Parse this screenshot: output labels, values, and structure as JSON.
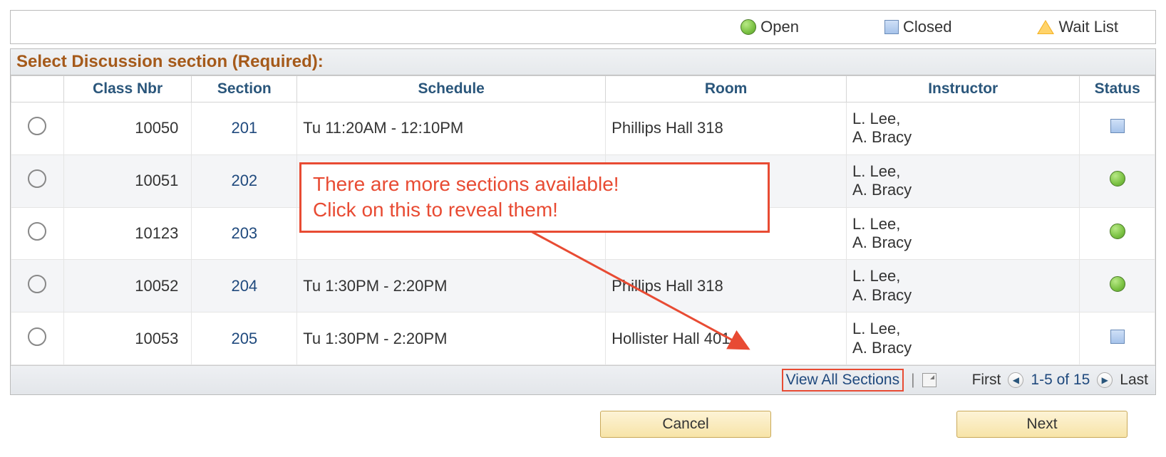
{
  "legend": {
    "open": "Open",
    "closed": "Closed",
    "waitlist": "Wait List"
  },
  "section_title": "Select Discussion section (Required):",
  "columns": {
    "class_nbr": "Class Nbr",
    "section": "Section",
    "schedule": "Schedule",
    "room": "Room",
    "instructor": "Instructor",
    "status": "Status"
  },
  "rows": [
    {
      "nbr": "10050",
      "section": "201",
      "schedule": "Tu 11:20AM - 12:10PM",
      "room": "Phillips Hall 318",
      "instructor": "L. Lee,\nA. Bracy",
      "status": "closed"
    },
    {
      "nbr": "10051",
      "section": "202",
      "schedule": "",
      "room": "",
      "instructor": "L. Lee,\nA. Bracy",
      "status": "open"
    },
    {
      "nbr": "10123",
      "section": "203",
      "schedule": "",
      "room": "",
      "instructor": "L. Lee,\nA. Bracy",
      "status": "open"
    },
    {
      "nbr": "10052",
      "section": "204",
      "schedule": "Tu 1:30PM - 2:20PM",
      "room": "Phillips Hall 318",
      "instructor": "L. Lee,\nA. Bracy",
      "status": "open"
    },
    {
      "nbr": "10053",
      "section": "205",
      "schedule": "Tu 1:30PM - 2:20PM",
      "room": "Hollister Hall 401",
      "instructor": "L. Lee,\nA. Bracy",
      "status": "closed"
    }
  ],
  "footer": {
    "view_all": "View All Sections",
    "first": "First",
    "range": "1-5 of 15",
    "last": "Last"
  },
  "buttons": {
    "cancel": "Cancel",
    "next": "Next"
  },
  "annotation": {
    "line1": "There are more sections available!",
    "line2": "Click on this to reveal them!"
  }
}
